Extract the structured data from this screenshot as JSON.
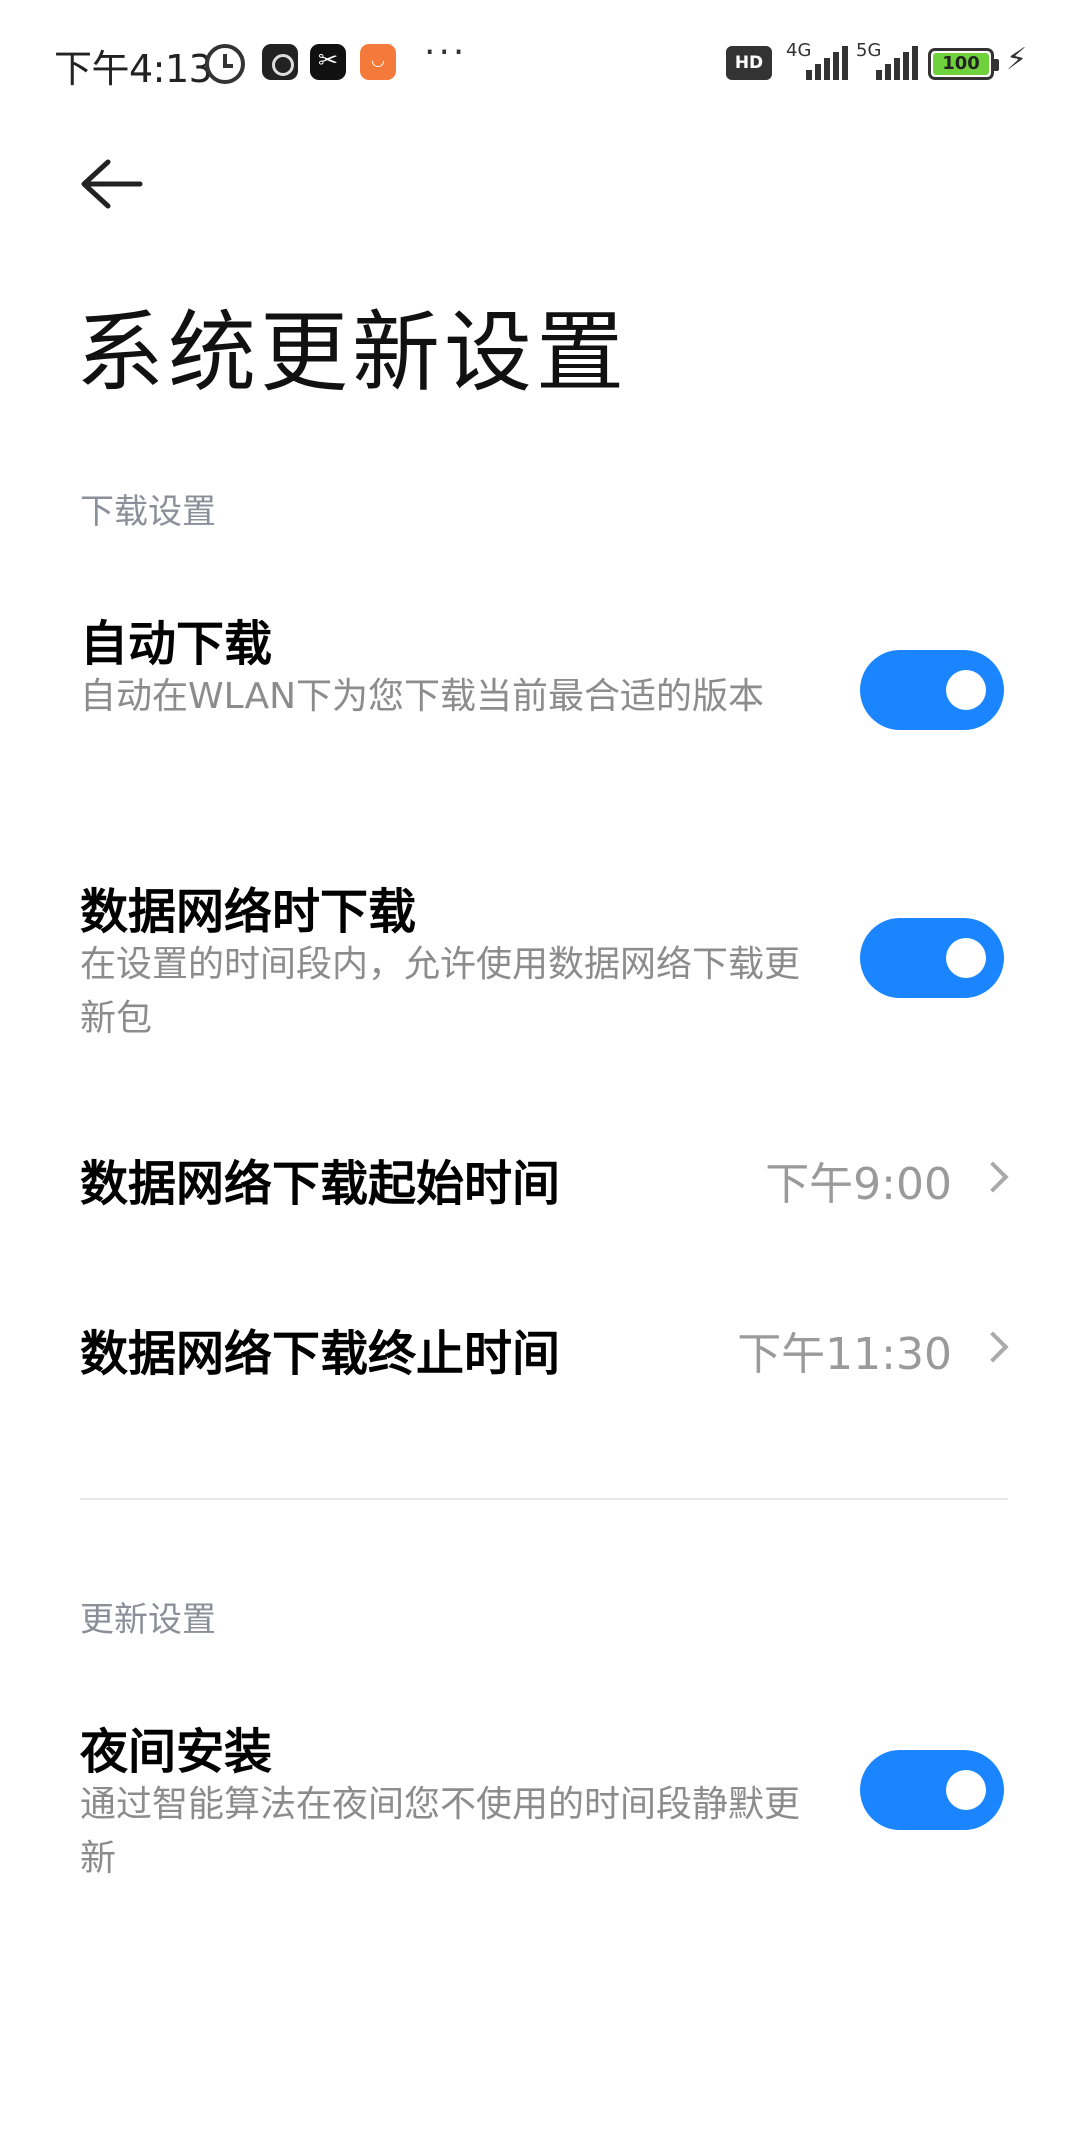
{
  "status_bar": {
    "time": "下午4:13",
    "hd_label": "HD",
    "net1_label": "4G",
    "net2_label": "5G",
    "battery_text": "100",
    "battery_level": 1.0,
    "battery_color": "#6fd23d",
    "icons": [
      "alarm-icon",
      "app-icon",
      "capcut-icon",
      "taobao-icon",
      "more-icon",
      "signal-icon",
      "battery-icon",
      "charging-icon"
    ]
  },
  "header": {
    "title": "系统更新设置"
  },
  "sections": {
    "download": {
      "label": "下载设置",
      "auto_download": {
        "title": "自动下载",
        "desc": "自动在WLAN下为您下载当前最合适的版本",
        "enabled": true
      },
      "data_download": {
        "title": "数据网络时下载",
        "desc": "在设置的时间段内，允许使用数据网络下载更新包",
        "enabled": true
      },
      "start_time": {
        "title": "数据网络下载起始时间",
        "value": "下午9:00"
      },
      "end_time": {
        "title": "数据网络下载终止时间",
        "value": "下午11:30"
      }
    },
    "update": {
      "label": "更新设置",
      "night_install": {
        "title": "夜间安装",
        "desc": "通过智能算法在夜间您不使用的时间段静默更新",
        "enabled": true
      }
    }
  },
  "colors": {
    "accent": "#1a85ff",
    "section_label": "#8a8f99",
    "desc": "#8c8c8c"
  }
}
